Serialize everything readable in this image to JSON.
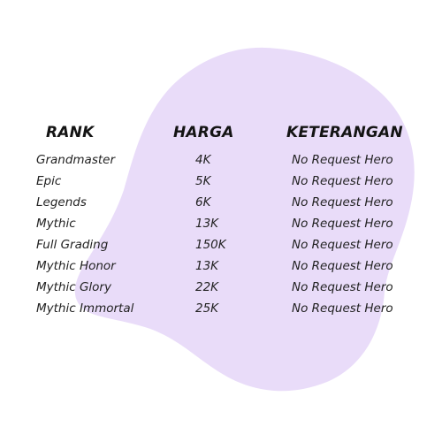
{
  "colors": {
    "blob": "#e9dcf9",
    "text": "#1d1d1d",
    "background": "#ffffff"
  },
  "table": {
    "headers": {
      "rank": "RANK",
      "harga": "HARGA",
      "keterangan": "KETERANGAN"
    },
    "rows": [
      {
        "rank": "Grandmaster",
        "harga": "4K",
        "keterangan": "No Request Hero"
      },
      {
        "rank": "Epic",
        "harga": "5K",
        "keterangan": "No Request Hero"
      },
      {
        "rank": "Legends",
        "harga": "6K",
        "keterangan": "No Request Hero"
      },
      {
        "rank": "Mythic",
        "harga": "13K",
        "keterangan": "No Request Hero"
      },
      {
        "rank": "Full Grading",
        "harga": "150K",
        "keterangan": "No Request Hero"
      },
      {
        "rank": "Mythic Honor",
        "harga": "13K",
        "keterangan": "No Request Hero"
      },
      {
        "rank": "Mythic Glory",
        "harga": "22K",
        "keterangan": "No Request Hero"
      },
      {
        "rank": "Mythic Immortal",
        "harga": "25K",
        "keterangan": "No Request Hero"
      }
    ]
  }
}
